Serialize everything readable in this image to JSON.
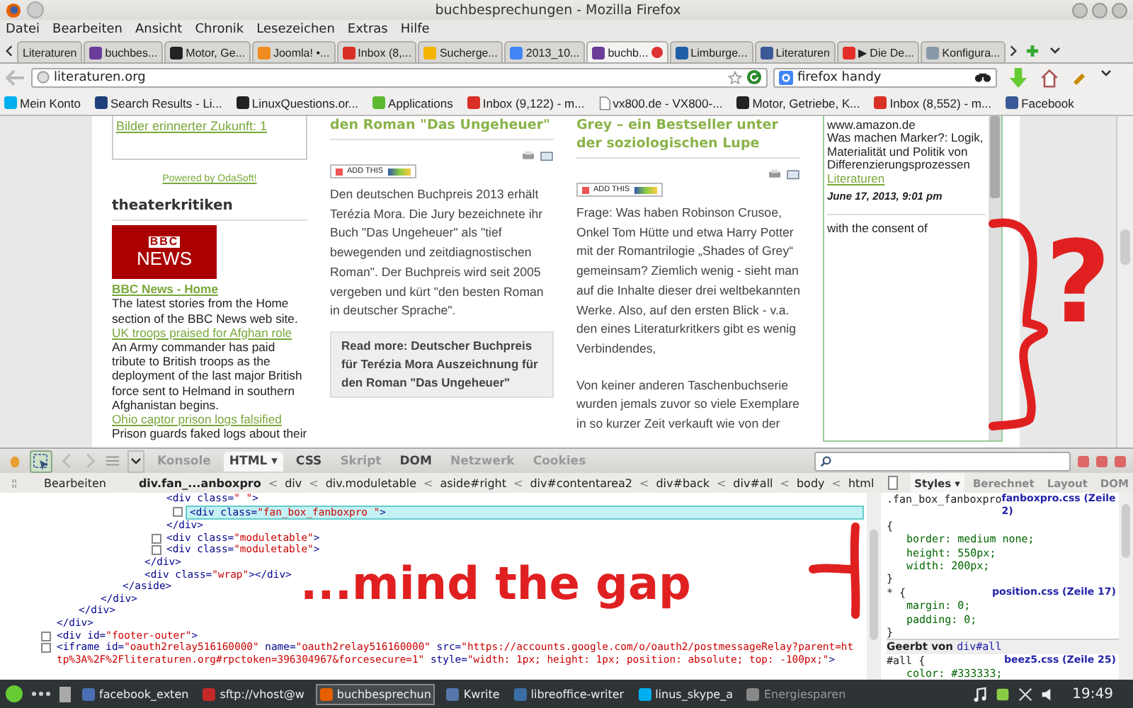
{
  "window": {
    "title": "buchbesprechungen - Mozilla Firefox"
  },
  "menu": [
    "Datei",
    "Bearbeiten",
    "Ansicht",
    "Chronik",
    "Lesezeichen",
    "Extras",
    "Hilfe"
  ],
  "tabs": [
    {
      "label": "Literaturen",
      "selected": false
    },
    {
      "label": "buchbes...",
      "selected": false,
      "color": "#6a3d9a"
    },
    {
      "label": "Motor, Ge...",
      "selected": false,
      "color": "#222222"
    },
    {
      "label": "Joomla! •...",
      "selected": false,
      "color": "#f08c1e"
    },
    {
      "label": "Inbox (8,...",
      "selected": false,
      "color": "#d93025"
    },
    {
      "label": "Sucherge...",
      "selected": false,
      "color": "#f4b400"
    },
    {
      "label": "2013_10...",
      "selected": false,
      "color": "#4285f4"
    },
    {
      "label": "buchb...",
      "selected": true,
      "color": "#6a3d9a"
    },
    {
      "label": "Limburge...",
      "selected": false,
      "color": "#1f5fa8"
    },
    {
      "label": "Literaturen",
      "selected": false,
      "color": "#3b5998"
    },
    {
      "label": "▶ Die De...",
      "selected": false,
      "color": "#e52d27"
    },
    {
      "label": "Konfigura...",
      "selected": false,
      "color": "#8899aa"
    }
  ],
  "navigation": {
    "url": "literaturen.org",
    "search": "firefox handy"
  },
  "bookmarks": [
    {
      "label": "Mein Konto",
      "color": "#00aff0"
    },
    {
      "label": "Search Results - Li...",
      "color": "#1f3f7a"
    },
    {
      "label": "LinuxQuestions.or...",
      "color": "#222222"
    },
    {
      "label": "Applications",
      "color": "#5cb82f"
    },
    {
      "label": "Inbox (9,122) - m...",
      "color": "#d93025"
    },
    {
      "label": "vx800.de - VX800-..."
    },
    {
      "label": "Motor, Getriebe, K...",
      "color": "#222222"
    },
    {
      "label": "Inbox (8,552) - m...",
      "color": "#d93025"
    },
    {
      "label": "Facebook",
      "color": "#3b5998"
    }
  ],
  "page": {
    "sidebar": {
      "box_link": "Bilder erinnerter Zukunft: 1",
      "powered": "Powered by OdaSoft!",
      "heading": "theaterkritiken",
      "logo": [
        "BBC",
        "NEWS"
      ],
      "feed_title": "BBC News - Home",
      "feed_description": "The latest stories from the Home section of the BBC News web site.",
      "items": [
        {
          "title": "UK troops praised for Afghan role",
          "text": "An Army commander has paid tribute to British troops as the deployment of the last major British force sent to Helmand in southern Afghanistan begins."
        },
        {
          "title": "Ohio captor prison logs falsified",
          "text": "Prison guards faked logs about their"
        }
      ]
    },
    "articles": [
      {
        "heading": "den Roman \"Das Ungeheuer\"",
        "share": "ADD THIS",
        "paragraphs": [
          "Den deutschen Buchpreis 2013 erhält Terézia Mora. Die Jury bezeichnete ihr Buch \"Das Ungeheuer\" als \"tief bewegenden und zeitdiagnostischen Roman\".  Der Buchpreis wird seit 2005 vergeben und kürt \"den besten Roman in deutscher Sprache\"."
        ],
        "read_more": "Read more: Deutscher Buchpreis für Terézia Mora Auszeichnung für den Roman \"Das Ungeheuer\""
      },
      {
        "heading": "Grey – ein Bestseller unter der soziologischen Lupe",
        "share": "ADD THIS",
        "paragraphs": [
          "Frage: Was haben Robinson Crusoe, Onkel Tom Hütte und etwa Harry Potter mit der Romantrilogie „Shades of Grey“ gemeinsam? Ziemlich wenig - sieht man auf die Inhalte dieser drei weltbekannten Werke. Also, auf den ersten Blick - v.a. den eines Literaturkritkers gibt es wenig Verbindendes,",
          "Von keiner anderen Taschenbuchserie wurden jemals zuvor so viele Exemplare in so kurzer Zeit verkauft wie von der"
        ]
      }
    ],
    "feed_box": {
      "source": "www.amazon.de",
      "title": "Was machen Marker?: Logik, Materialität und Politik von Differenzierungsprozessen",
      "link": "Literaturen",
      "date": "June 17, 2013, 9:01 pm",
      "next": "with the consent of"
    }
  },
  "devtools": {
    "tabs": [
      {
        "label": "Konsole",
        "selected": false,
        "disabled": true
      },
      {
        "label": "HTML ▾",
        "selected": true,
        "disabled": false
      },
      {
        "label": "CSS",
        "selected": false,
        "disabled": false
      },
      {
        "label": "Skript",
        "selected": false,
        "disabled": true
      },
      {
        "label": "DOM",
        "selected": false,
        "disabled": false
      },
      {
        "label": "Netzwerk",
        "selected": false,
        "disabled": true
      },
      {
        "label": "Cookies",
        "selected": false,
        "disabled": true
      }
    ],
    "edit_button": "Bearbeiten",
    "breadcrumbs": [
      {
        "label": "div.fan_...anboxpro",
        "selected": true
      },
      {
        "prefix": "<",
        "label": "div",
        "selected": false
      },
      {
        "prefix": "<",
        "label": "div.moduletable",
        "selected": false
      },
      {
        "prefix": "<",
        "label": "aside#right",
        "selected": false
      },
      {
        "prefix": "<",
        "label": "div#contentarea2",
        "selected": false
      },
      {
        "prefix": "<",
        "label": "div#back",
        "selected": false
      },
      {
        "prefix": "<",
        "label": "div#all",
        "selected": false
      },
      {
        "prefix": "<",
        "label": "body",
        "selected": false
      },
      {
        "prefix": "<",
        "label": "html",
        "selected": false
      }
    ],
    "tree": [
      {
        "close": "</div>",
        "expandable": false,
        "selected": false,
        "children": [
          {
            "close": "</div>",
            "expandable": false,
            "selected": false,
            "children": [
              {
                "close": "</div>",
                "expandable": false,
                "selected": false,
                "children": [
                  {
                    "close": "</aside>",
                    "expandable": false,
                    "selected": false,
                    "children": [
                      {
                        "close": "</div>",
                        "expandable": false,
                        "selected": false,
                        "children": [
                          {
                            "open": "<div class=\" \">",
                            "close": "</div>",
                            "expandable": false,
                            "selected": false,
                            "children": [
                              {
                                "open": "<div class=\"fan_box_fanboxpro \">",
                                "expandable": true,
                                "selected": true
                              }
                            ]
                          },
                          {
                            "open": "<div class=\"moduletable\">",
                            "expandable": true,
                            "selected": false
                          },
                          {
                            "open": "<div class=\"moduletable\">",
                            "expandable": true,
                            "selected": false
                          }
                        ]
                      },
                      {
                        "open": "<div class=\"wrap\"></div>",
                        "expandable": false,
                        "selected": false
                      }
                    ]
                  }
                ]
              }
            ]
          }
        ]
      },
      {
        "open": "<div id=\"footer-outer\">",
        "expandable": true,
        "selected": false
      },
      {
        "open": "<iframe id=\"oauth2relay516160000\" name=\"oauth2relay516160000\" src=\"https://accounts.google.com/o/oauth2/postmessageRelay?parent=http%3A%2F%2Fliteraturen.org#rpctoken=396304967&forcesecure=1\" style=\"width: 1px; height: 1px; position: absolute; top: -100px;\">",
        "expandable": true,
        "selected": false
      }
    ],
    "side_tabs": [
      {
        "label": "Styles ▾",
        "selected": true
      },
      {
        "label": "Berechnet",
        "selected": false
      },
      {
        "label": "Layout",
        "selected": false
      },
      {
        "label": "DOM",
        "selected": false
      }
    ],
    "rules": [
      {
        "selector": ".fan_box_fanboxpro",
        "source": "fanboxpro.css (Zeile 2)",
        "open": "{",
        "declarations": [
          "border: medium none;",
          "height: 550px;",
          "width: 200px;"
        ],
        "close": "}"
      },
      {
        "selector": "* {",
        "source": "position.css (Zeile 17)",
        "declarations": [
          "margin: 0;",
          "padding: 0;"
        ],
        "close": "}"
      },
      {
        "inherited": "Geerbt von",
        "inherited_from": "div#all",
        "selector": "#all {",
        "source": "beez5.css (Zeile 25)",
        "declarations": [
          "color: #333333;"
        ]
      }
    ]
  },
  "annotations": {
    "note": "...mind the gap",
    "mark": "?"
  },
  "taskbar": {
    "items": [
      {
        "label": "facebook_exten",
        "selected": false,
        "color": "#4a6fb5"
      },
      {
        "label": "sftp://vhost@w",
        "selected": false,
        "color": "#c62828"
      },
      {
        "label": "buchbesprechun",
        "selected": true,
        "color": "#e66000"
      },
      {
        "label": "Kwrite",
        "selected": false,
        "color": "#5577aa"
      },
      {
        "label": "libreoffice-writer",
        "selected": false,
        "color": "#3a6ea5"
      },
      {
        "label": "linus_skype_a",
        "selected": false,
        "color": "#00aff0"
      },
      {
        "label": "Energiesparen",
        "selected": false,
        "disabled": true,
        "color": "#888888"
      }
    ],
    "clock": "19:49"
  }
}
